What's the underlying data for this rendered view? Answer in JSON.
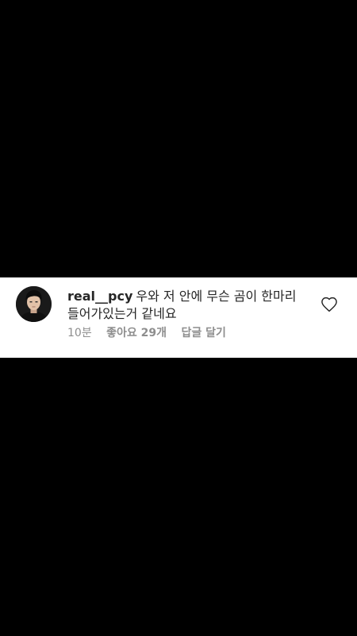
{
  "comment": {
    "username": "real__pcy",
    "text": "우와 저 안에 무슨 곰이 한마리 들어가있는거 같네요",
    "time": "10분",
    "likes": "좋아요 29개",
    "reply": "답글 달기"
  },
  "icons": {
    "like": "heart-outline-icon",
    "avatar": "profile-avatar"
  },
  "colors": {
    "background": "#000000",
    "card": "#ffffff",
    "text": "#262626",
    "meta": "#8e8e8e"
  }
}
